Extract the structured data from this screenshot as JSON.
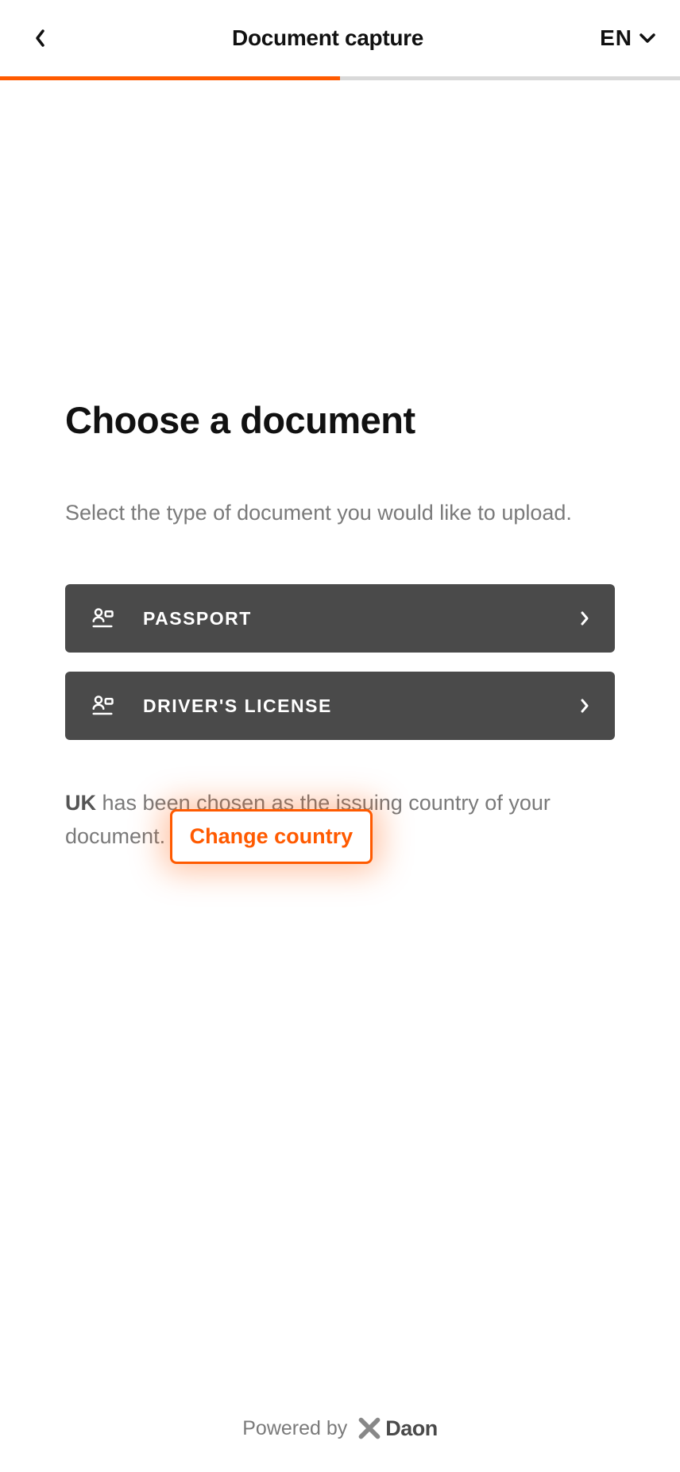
{
  "header": {
    "title": "Document capture",
    "lang_label": "EN"
  },
  "progress": {
    "percent": 50
  },
  "main": {
    "title": "Choose a document",
    "subtitle": "Select the type of document you would like to upload.",
    "options": [
      {
        "label": "PASSPORT"
      },
      {
        "label": "DRIVER'S LICENSE"
      }
    ],
    "country": {
      "code": "UK",
      "text_before": " has been chosen as the issuing country of your document. ",
      "change_label": "Change country"
    }
  },
  "footer": {
    "powered_by": "Powered by",
    "brand": "Daon"
  }
}
